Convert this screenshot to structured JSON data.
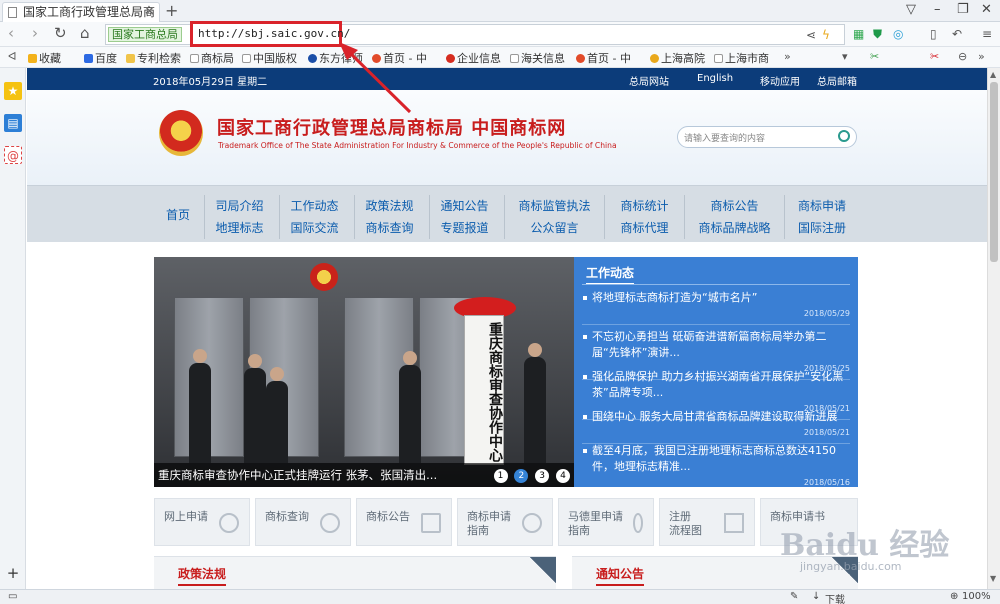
{
  "browser": {
    "tab_title": "国家工商行政管理总局商",
    "new_tab": "+",
    "site_badge": "国家工商总局",
    "url": "http://sbj.saic.gov.cn/",
    "bookmarks": [
      {
        "label": "收藏",
        "color": "#f3b21b"
      },
      {
        "label": "百度",
        "color": "#2d6ae3"
      },
      {
        "label": "专利检索",
        "color": "#f0c44a"
      },
      {
        "label": "商标局",
        "color": "#cccccc"
      },
      {
        "label": "中国版权",
        "color": "#cccccc"
      },
      {
        "label": "东方律师",
        "color": "#1b4fa8"
      },
      {
        "label": "首页 - 中",
        "color": "#e24b2a"
      },
      {
        "label": "企业信息",
        "color": "#d62d20"
      },
      {
        "label": "海关信息",
        "color": "#cccccc"
      },
      {
        "label": "首页 - 中",
        "color": "#e24b2a"
      },
      {
        "label": "上海高院",
        "color": "#e9a81b"
      },
      {
        "label": "上海市商",
        "color": "#cccccc"
      }
    ],
    "status": {
      "download": "下载",
      "zoom": "100%"
    }
  },
  "site": {
    "date": "2018年05月29日 星期二",
    "top_links": [
      "总局网站",
      "English",
      "移动应用",
      "总局邮箱"
    ],
    "title_cn": "国家工商行政管理总局商标局 中国商标网",
    "title_en": "Trademark Office of The State Administration For Industry & Commerce of the People's Republic of China",
    "search_placeholder": "请输入要查询的内容",
    "menu": {
      "home": "首页",
      "columns": [
        [
          "司局介绍",
          "地理标志"
        ],
        [
          "工作动态",
          "国际交流"
        ],
        [
          "政策法规",
          "商标查询"
        ],
        [
          "通知公告",
          "专题报道"
        ],
        [
          "商标监管执法",
          "公众留言"
        ],
        [
          "商标统计",
          "商标代理"
        ],
        [
          "商标公告",
          "商标品牌战略"
        ],
        [
          "商标申请",
          "国际注册"
        ]
      ]
    },
    "hero": {
      "caption": "重庆商标审查协作中心正式挂牌运行 张茅、张国清出...",
      "plaque": "重庆商标审查协作中心",
      "dots": [
        "1",
        "2",
        "3",
        "4"
      ],
      "active_dot": 1
    },
    "news": {
      "heading": "工作动态",
      "items": [
        {
          "title": "将地理标志商标打造为“城市名片”",
          "date": "2018/05/29"
        },
        {
          "title": "不忘初心勇担当 砥砺奋进谱新篇商标局举办第二届“先锋杯”演讲...",
          "date": "2018/05/25"
        },
        {
          "title": "强化品牌保护 助力乡村振兴湖南省开展保护“安化黑茶”品牌专项...",
          "date": "2018/05/21"
        },
        {
          "title": "围绕中心 服务大局甘肃省商标品牌建设取得新进展",
          "date": "2018/05/21"
        },
        {
          "title": "截至4月底，我国已注册地理标志商标总数达4150件，地理标志精准...",
          "date": "2018/05/16"
        }
      ]
    },
    "quick_links": [
      "网上申请",
      "商标查询",
      "商标公告",
      "商标申请\n指南",
      "马德里申请\n指南",
      "注册\n流程图",
      "商标申请书"
    ],
    "panels": [
      "政策法规",
      "通知公告"
    ]
  },
  "watermark": {
    "brand": "Baidu 经验",
    "url": "jingyan.baidu.com"
  }
}
